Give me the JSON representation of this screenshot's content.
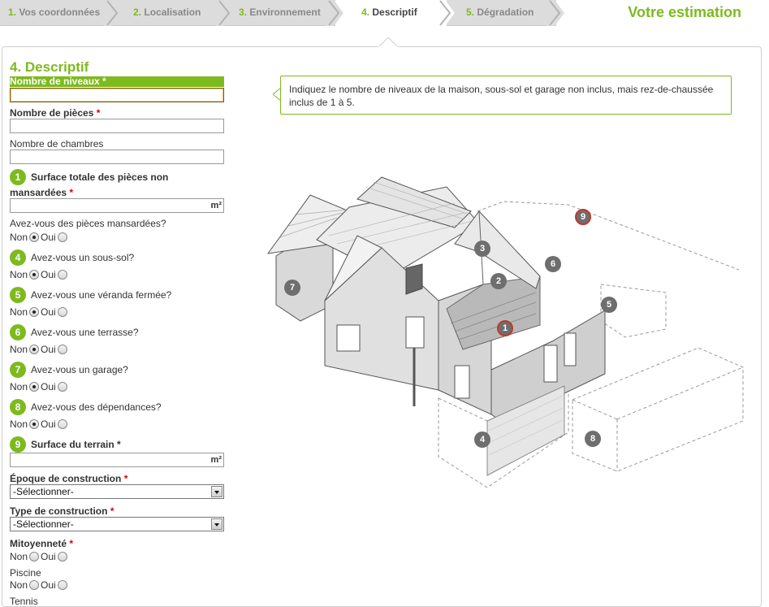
{
  "steps": [
    {
      "num": "1.",
      "label": "Vos coordonnées"
    },
    {
      "num": "2.",
      "label": "Localisation"
    },
    {
      "num": "3.",
      "label": "Environnement"
    },
    {
      "num": "4.",
      "label": "Descriptif"
    },
    {
      "num": "5.",
      "label": "Dégradation"
    }
  ],
  "header": {
    "estimate": "Votre estimation"
  },
  "form": {
    "title": "4. Descriptif",
    "niveaux": {
      "label": "Nombre de niveaux",
      "req": "*"
    },
    "pieces": {
      "label": "Nombre de pièces",
      "req": "*"
    },
    "chambres": {
      "label": "Nombre de chambres"
    },
    "surface": {
      "badge": "1",
      "label1": "Surface totale des pièces non",
      "label2": "mansardées",
      "req": "*",
      "unit": "m²"
    },
    "mansardees": {
      "label": "Avez-vous des pièces mansardées?"
    },
    "soussol": {
      "badge": "4",
      "label": "Avez-vous un sous-sol?"
    },
    "veranda": {
      "badge": "5",
      "label": "Avez-vous une véranda fermée?"
    },
    "terrasse": {
      "badge": "6",
      "label": "Avez-vous une terrasse?"
    },
    "garage": {
      "badge": "7",
      "label": "Avez-vous un garage?"
    },
    "dependances": {
      "badge": "8",
      "label": "Avez-vous des dépendances?"
    },
    "terrain": {
      "badge": "9",
      "label": "Surface du terrain",
      "req": "*",
      "unit": "m²"
    },
    "epoque": {
      "label": "Époque de construction",
      "req": "*",
      "value": "-Sélectionner-"
    },
    "type": {
      "label": "Type de construction",
      "req": "*",
      "value": "-Sélectionner-"
    },
    "mitoyennete": {
      "label": "Mitoyenneté",
      "req": "*"
    },
    "piscine": {
      "label": "Piscine"
    },
    "tennis": {
      "label": "Tennis"
    },
    "non": "Non",
    "oui": "Oui"
  },
  "tooltip": {
    "text": "Indiquez le nombre de niveaux de la maison, sous-sol et garage non inclus, mais rez-de-chaussée inclus de 1 à 5."
  },
  "markers": [
    "1",
    "2",
    "3",
    "4",
    "5",
    "6",
    "7",
    "8",
    "9"
  ],
  "colors": {
    "accent": "#7dba1e",
    "required": "#dd0000",
    "marker": "#6e6e6e",
    "marker_highlight": "#c0392b"
  }
}
